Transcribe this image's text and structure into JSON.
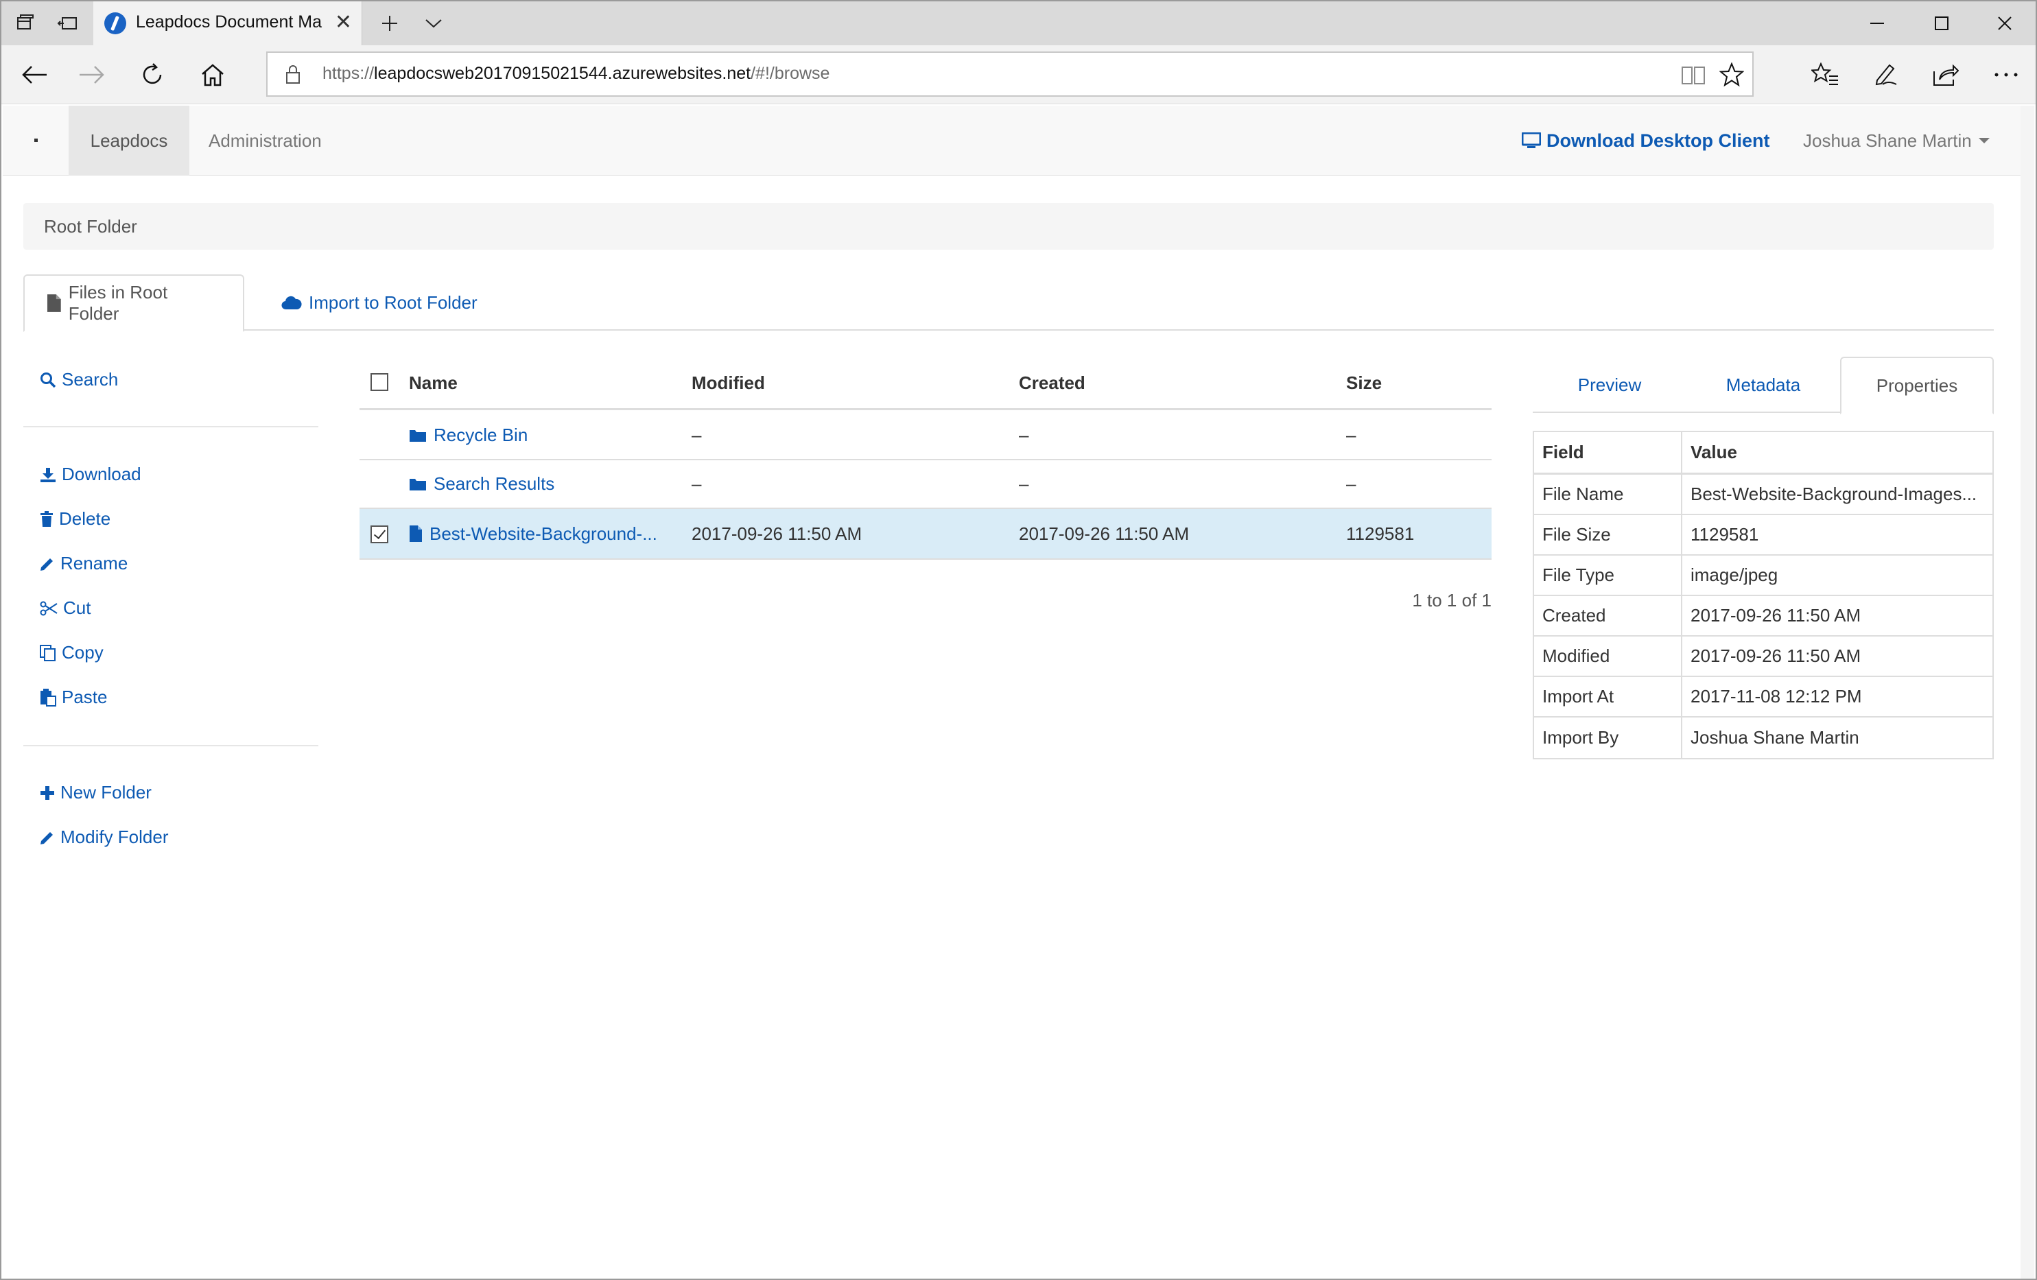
{
  "browser": {
    "tab_title": "Leapdocs Document Ma",
    "url_scheme": "https://",
    "url_host": "leapdocsweb20170915021544.azurewebsites.net",
    "url_path": "/#!/browse"
  },
  "header": {
    "nav_active": "Leapdocs",
    "nav_admin": "Administration",
    "download_client": "Download Desktop Client",
    "user_name": "Joshua Shane Martin"
  },
  "breadcrumb": "Root Folder",
  "tabs": {
    "files": "Files in Root Folder",
    "import": "Import to Root Folder"
  },
  "actions": {
    "search": "Search",
    "download": "Download",
    "delete": "Delete",
    "rename": "Rename",
    "cut": "Cut",
    "copy": "Copy",
    "paste": "Paste",
    "new_folder": "New Folder",
    "modify_folder": "Modify Folder"
  },
  "grid": {
    "columns": [
      "Name",
      "Modified",
      "Created",
      "Size"
    ],
    "rows": [
      {
        "name": "Recycle Bin",
        "modified": "–",
        "created": "–",
        "size": "–",
        "type": "folder"
      },
      {
        "name": "Search Results",
        "modified": "–",
        "created": "–",
        "size": "–",
        "type": "folder"
      },
      {
        "name": "Best-Website-Background-...",
        "modified": "2017-09-26 11:50 AM",
        "created": "2017-09-26 11:50 AM",
        "size": "1129581",
        "type": "file",
        "selected": true
      }
    ],
    "pager": "1 to 1 of 1"
  },
  "right_panel": {
    "tabs": [
      "Preview",
      "Metadata",
      "Properties"
    ],
    "active_tab": "Properties",
    "columns": [
      "Field",
      "Value"
    ],
    "rows": [
      {
        "field": "File Name",
        "value": "Best-Website-Background-Images..."
      },
      {
        "field": "File Size",
        "value": "1129581"
      },
      {
        "field": "File Type",
        "value": "image/jpeg"
      },
      {
        "field": "Created",
        "value": "2017-09-26 11:50 AM"
      },
      {
        "field": "Modified",
        "value": "2017-09-26 11:50 AM"
      },
      {
        "field": "Import At",
        "value": "2017-11-08 12:12 PM"
      },
      {
        "field": "Import By",
        "value": "Joshua Shane Martin"
      }
    ]
  },
  "colors": {
    "link": "#0d5ab3",
    "selected_row": "#d9ecf7"
  }
}
